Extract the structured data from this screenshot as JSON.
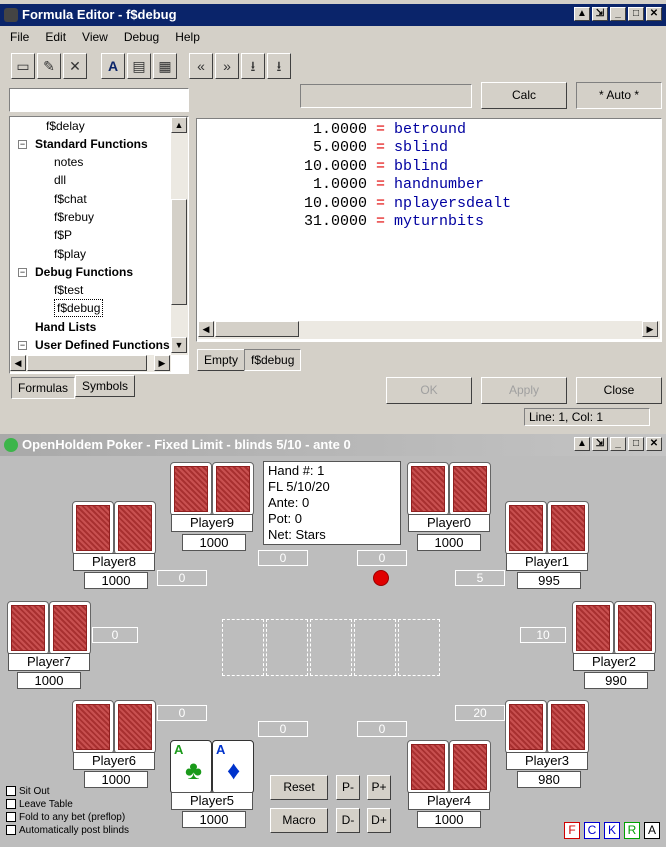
{
  "editor": {
    "title": "Formula Editor - f$debug",
    "menu": [
      "File",
      "Edit",
      "View",
      "Debug",
      "Help"
    ],
    "toolbar_icons": [
      "new-icon",
      "edit-icon",
      "delete-icon",
      "font-icon",
      "properties-icon",
      "grid-icon",
      "shift-left-icon",
      "shift-right-icon",
      "collapse-icon",
      "expand-icon"
    ],
    "calc_label": "Calc",
    "auto_label": "* Auto *",
    "tree": [
      {
        "label": "f$delay",
        "level": 2,
        "bold": false
      },
      {
        "label": "Standard Functions",
        "level": 1,
        "bold": true
      },
      {
        "label": "notes",
        "level": 2,
        "bold": false
      },
      {
        "label": "dll",
        "level": 2,
        "bold": false
      },
      {
        "label": "f$chat",
        "level": 2,
        "bold": false
      },
      {
        "label": "f$rebuy",
        "level": 2,
        "bold": false
      },
      {
        "label": "f$P",
        "level": 2,
        "bold": false
      },
      {
        "label": "f$play",
        "level": 2,
        "bold": false
      },
      {
        "label": "Debug Functions",
        "level": 1,
        "bold": true
      },
      {
        "label": "f$test",
        "level": 2,
        "bold": false
      },
      {
        "label": "f$debug",
        "level": 2,
        "bold": false
      },
      {
        "label": "Hand Lists",
        "level": 1,
        "bold": true
      },
      {
        "label": "User Defined Functions",
        "level": 1,
        "bold": true
      }
    ],
    "lines": [
      {
        "value": "1.0000",
        "var": "betround"
      },
      {
        "value": "5.0000",
        "var": "sblind"
      },
      {
        "value": "10.0000",
        "var": "bblind"
      },
      {
        "value": "1.0000",
        "var": "handnumber"
      },
      {
        "value": "10.0000",
        "var": "nplayersdealt"
      },
      {
        "value": "31.0000",
        "var": "myturnbits"
      }
    ],
    "eq": "=",
    "editor_tabs": [
      "Empty",
      "f$debug"
    ],
    "left_tabs": [
      "Formulas",
      "Symbols"
    ],
    "ok_label": "OK",
    "apply_label": "Apply",
    "close_label": "Close",
    "status": "Line: 1, Col: 1"
  },
  "poker": {
    "title": "OpenHoldem Poker - Fixed Limit - blinds 5/10 - ante 0",
    "info": [
      "Hand #: 1",
      "FL 5/10/20",
      "Ante: 0",
      "Pot: 0",
      "Net: Stars"
    ],
    "players": [
      {
        "name": "Player0",
        "chips": "1000",
        "bet": "0"
      },
      {
        "name": "Player1",
        "chips": "995",
        "bet": "5"
      },
      {
        "name": "Player2",
        "chips": "990",
        "bet": "10"
      },
      {
        "name": "Player3",
        "chips": "980",
        "bet": "20"
      },
      {
        "name": "Player4",
        "chips": "1000",
        "bet": "0"
      },
      {
        "name": "Player5",
        "chips": "1000",
        "bet": ""
      },
      {
        "name": "Player6",
        "chips": "1000",
        "bet": "0"
      },
      {
        "name": "Player7",
        "chips": "1000",
        "bet": "0"
      },
      {
        "name": "Player8",
        "chips": "1000",
        "bet": "0"
      },
      {
        "name": "Player9",
        "chips": "1000",
        "bet": "0"
      }
    ],
    "hero_cards": [
      {
        "rank": "A",
        "suit": "♣",
        "color": "#1a9a1a"
      },
      {
        "rank": "A",
        "suit": "♦",
        "color": "#0033cc"
      }
    ],
    "buttons": {
      "reset": "Reset",
      "macro": "Macro",
      "pminus": "P-",
      "pplus": "P+",
      "dminus": "D-",
      "dplus": "D+"
    },
    "checkboxes": [
      "Sit Out",
      "Leave Table",
      "Fold to any bet (preflop)",
      "Automatically post blinds"
    ],
    "flags": [
      {
        "l": "F",
        "c": "#d00000"
      },
      {
        "l": "C",
        "c": "#0000d0"
      },
      {
        "l": "K",
        "c": "#0000d0"
      },
      {
        "l": "R",
        "c": "#00a000"
      },
      {
        "l": "A",
        "c": "#000000"
      }
    ]
  }
}
